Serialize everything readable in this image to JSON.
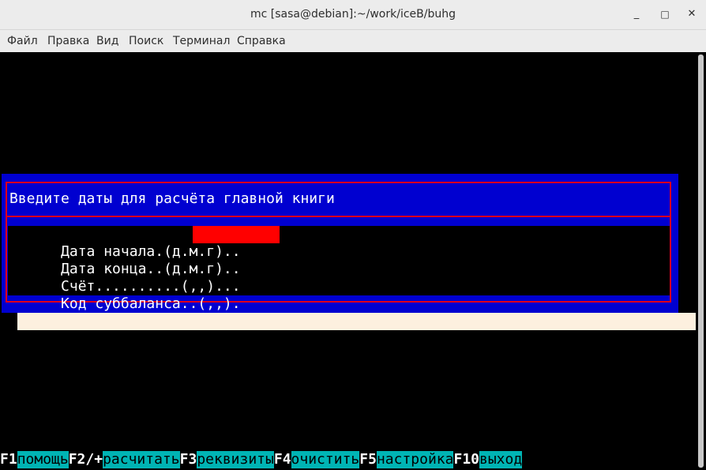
{
  "window": {
    "title": "mc [sasa@debian]:~/work/iceB/buhg",
    "buttons": {
      "minimize": "_",
      "maximize": "□",
      "close": "✕"
    }
  },
  "menu": [
    "Файл",
    "Правка",
    "Вид",
    "Поиск",
    "Терминал",
    "Справка"
  ],
  "dialog": {
    "title": "Введите даты для расчёта главной книги",
    "fields": [
      {
        "label": "Дата начала.(д.м.г)..",
        "value": ""
      },
      {
        "label": "Дата конца..(д.м.г)..",
        "value": ""
      },
      {
        "label": "Счёт..........(,,)...",
        "value": ""
      },
      {
        "label": "Код суббаланса..(,,).",
        "value": ""
      }
    ]
  },
  "fkeys": [
    {
      "key": "F1",
      "label": "помощь"
    },
    {
      "key": "F2/+",
      "label": "расчитать"
    },
    {
      "key": "F3",
      "label": "реквизиты"
    },
    {
      "key": "F4",
      "label": "очистить"
    },
    {
      "key": "F5",
      "label": "настройка"
    },
    {
      "key": "F10",
      "label": "выход"
    }
  ],
  "colors": {
    "terminal_bg": "#000000",
    "dialog_bg": "#0000d0",
    "frame": "#e0001a",
    "input_active": "#ff0000",
    "fkey_label_bg": "#00b4b4",
    "shadow": "#fdf0df"
  }
}
